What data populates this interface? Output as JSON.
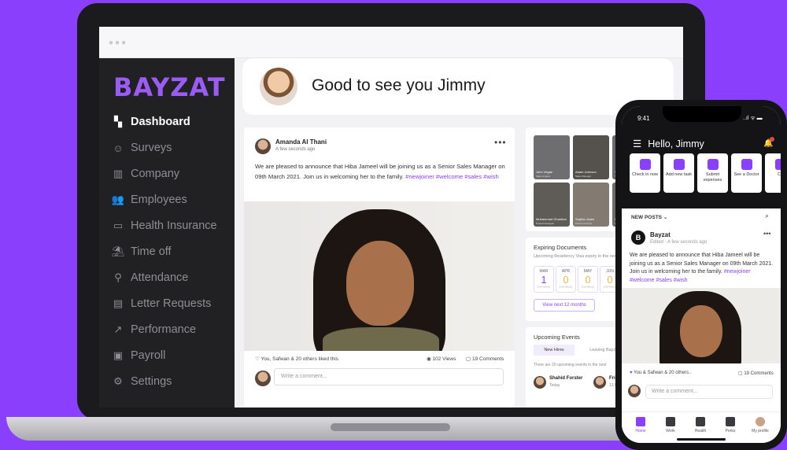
{
  "brand": {
    "logo": "BAYZAT",
    "accent": "#8a3ffc",
    "background": "#8a3ffc"
  },
  "sidebar": {
    "items": [
      {
        "label": "Dashboard",
        "icon": "dashboard-icon",
        "active": true
      },
      {
        "label": "Surveys",
        "icon": "smiley-icon"
      },
      {
        "label": "Company",
        "icon": "buildings-icon"
      },
      {
        "label": "Employees",
        "icon": "people-icon"
      },
      {
        "label": "Health Insurance",
        "icon": "card-icon"
      },
      {
        "label": "Time off",
        "icon": "beach-umbrella-icon"
      },
      {
        "label": "Attendance",
        "icon": "location-pin-icon"
      },
      {
        "label": "Letter Requests",
        "icon": "document-icon"
      },
      {
        "label": "Performance",
        "icon": "trend-up-icon"
      },
      {
        "label": "Payroll",
        "icon": "cash-icon"
      },
      {
        "label": "Settings",
        "icon": "gear-icon"
      }
    ]
  },
  "header": {
    "greeting": "Good to see you Jimmy"
  },
  "post": {
    "author": "Amanda Al Thani",
    "time": "A few seconds ago",
    "text": "We are pleased to announce that Hiba Jameel will be joining us as a Senior Sales Manager on 09th March 2021. Join us in welcoming her to the family.",
    "tags": "#newjoiner #welcome #sales #wish",
    "likes": "You, Safwan & 20 others liked this",
    "views": "102 Views",
    "comments": "19 Comments",
    "comment_placeholder": "Write a comment..."
  },
  "people": [
    {
      "name": "John Vegas",
      "role": "Sales Analyst"
    },
    {
      "name": "Adam Johnson",
      "role": "Sales Manager"
    },
    {
      "name": "Steve Bradl",
      "role": "Sales Exec"
    },
    {
      "name": "Muhammad Ghanthar",
      "role": "Product Designer"
    },
    {
      "name": "Sophia Jones",
      "role": "Finance Analyst"
    },
    {
      "name": "Gabrie",
      "role": "Sales Lead"
    }
  ],
  "docs": {
    "title": "Expiring Documents",
    "subtitle": "Upcoming Residency Visa expiry in the next",
    "months": [
      {
        "m": "MAR",
        "n": "1",
        "s": "EXPIRING"
      },
      {
        "m": "APR",
        "n": "0",
        "s": "EXPIRING"
      },
      {
        "m": "MAY",
        "n": "0",
        "s": "EXPIRING"
      },
      {
        "m": "JUN",
        "n": "0",
        "s": "EXPIRING"
      }
    ],
    "view_button": "View next 12 months"
  },
  "events": {
    "title": "Upcoming Events",
    "tab_new": "New Hires",
    "tab_leaving": "Leaving Bayzat",
    "info": "There are 20 upcoming events in the next",
    "e1_name": "Shahid Forster",
    "e1_date": "Today",
    "e2_name": "Fric",
    "e2_date": "13 M"
  },
  "phone": {
    "time": "9:41",
    "status": "..ıl ᯤ ▬",
    "greeting": "Hello, Jimmy",
    "actions": [
      "Check in now",
      "Add new task",
      "Submit expenses",
      "See a Doctor",
      "Ch"
    ],
    "new_posts": "NEW POSTS",
    "post_author": "Bayzat",
    "post_time": "Edited · A few seconds ago",
    "post_text": "We are pleased to announce that Hiba Jameel will be joining us as a Senior Sales Manager on 09th March 2021. Join us in welcoming her to the family.",
    "post_tags": "#newjoiner #welcome #sales #wish",
    "likes": "You & Safwan & 20 others..",
    "comments": "19 Comments",
    "comment_placeholder": "Write a comment...",
    "tabs": [
      "Home",
      "Work",
      "Health",
      "Perks",
      "My profile"
    ]
  }
}
